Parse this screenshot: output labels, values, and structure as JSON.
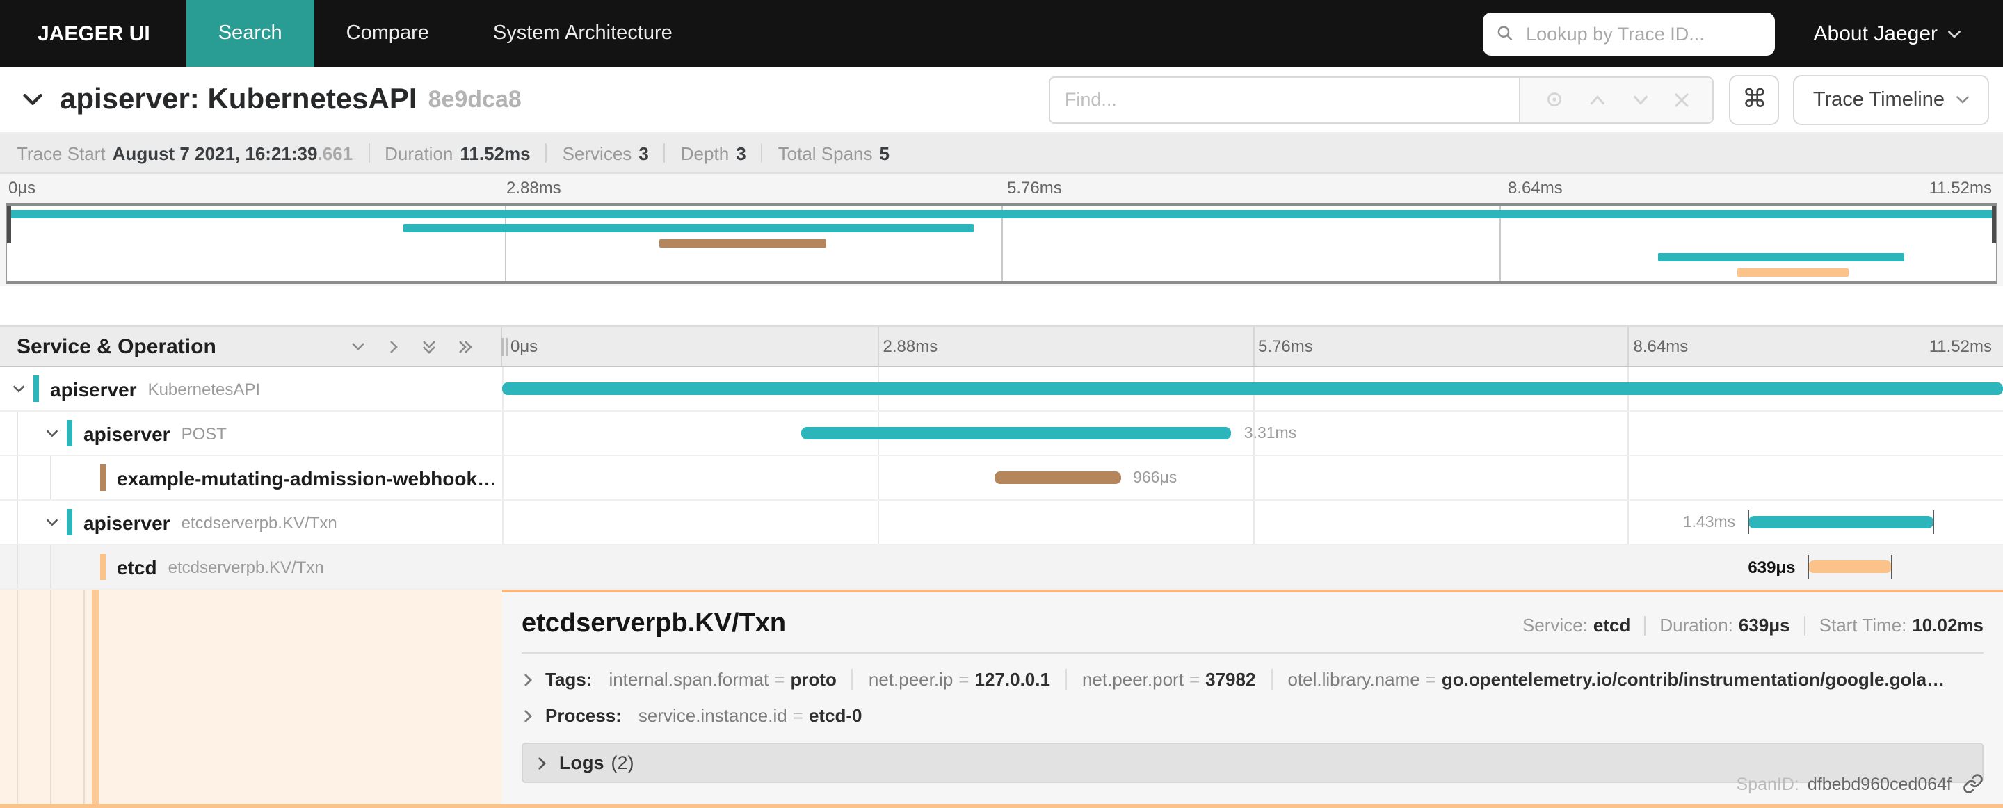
{
  "nav": {
    "brand": "JAEGER UI",
    "items": [
      {
        "label": "Search",
        "active": true
      },
      {
        "label": "Compare",
        "active": false
      },
      {
        "label": "System Architecture",
        "active": false
      }
    ],
    "lookup_placeholder": "Lookup by Trace ID...",
    "about_label": "About Jaeger"
  },
  "trace_bar": {
    "title": "apiserver: KubernetesAPI",
    "trace_id": "8e9dca8",
    "find_placeholder": "Find...",
    "keyboard_shortcut": "⌘",
    "view_selector_label": "Trace Timeline"
  },
  "summary": [
    {
      "label": "Trace Start",
      "value": "August 7 2021, 16:21:39",
      "suffix": ".661"
    },
    {
      "label": "Duration",
      "value": "11.52ms"
    },
    {
      "label": "Services",
      "value": "3"
    },
    {
      "label": "Depth",
      "value": "3"
    },
    {
      "label": "Total Spans",
      "value": "5"
    }
  ],
  "timeline": {
    "header_label": "Service & Operation",
    "ticks": [
      "0μs",
      "2.88ms",
      "5.76ms",
      "8.64ms",
      "11.52ms"
    ]
  },
  "spans": [
    {
      "service": "apiserver",
      "operation": "KubernetesAPI",
      "depth": 0,
      "color": "#2cb5ba",
      "start_pct": 0,
      "width_pct": 100,
      "duration_label": "",
      "label_side": "none",
      "expandable": true,
      "selected": false,
      "end_ticks": false
    },
    {
      "service": "apiserver",
      "operation": "POST",
      "depth": 1,
      "color": "#2cb5ba",
      "start_pct": 19.9,
      "width_pct": 28.7,
      "duration_label": "3.31ms",
      "label_side": "right",
      "expandable": true,
      "selected": false,
      "end_ticks": false
    },
    {
      "service": "example-mutating-admission-webhook…",
      "operation": "",
      "depth": 2,
      "color": "#b5855c",
      "start_pct": 32.8,
      "width_pct": 8.4,
      "duration_label": "966μs",
      "label_side": "right",
      "expandable": false,
      "selected": false,
      "end_ticks": false
    },
    {
      "service": "apiserver",
      "operation": "etcdserverpb.KV/Txn",
      "depth": 1,
      "color": "#2cb5ba",
      "start_pct": 83.0,
      "width_pct": 12.4,
      "duration_label": "1.43ms",
      "label_side": "left",
      "expandable": true,
      "selected": false,
      "end_ticks": true
    },
    {
      "service": "etcd",
      "operation": "etcdserverpb.KV/Txn",
      "depth": 2,
      "color": "#fbc28a",
      "start_pct": 87.0,
      "width_pct": 5.6,
      "duration_label": "639μs",
      "label_side": "left",
      "expandable": false,
      "selected": true,
      "end_ticks": true
    }
  ],
  "detail": {
    "operation": "etcdserverpb.KV/Txn",
    "overview": [
      {
        "label": "Service:",
        "value": "etcd"
      },
      {
        "label": "Duration:",
        "value": "639μs"
      },
      {
        "label": "Start Time:",
        "value": "10.02ms"
      }
    ],
    "tags_label": "Tags:",
    "tags": [
      {
        "key": "internal.span.format",
        "value": "proto"
      },
      {
        "key": "net.peer.ip",
        "value": "127.0.0.1"
      },
      {
        "key": "net.peer.port",
        "value": "37982"
      },
      {
        "key": "otel.library.name",
        "value": "go.opentelemetry.io/contrib/instrumentation/google.gola…"
      }
    ],
    "process_label": "Process:",
    "process_tags": [
      {
        "key": "service.instance.id",
        "value": "etcd-0"
      }
    ],
    "logs_label": "Logs",
    "logs_count": "(2)",
    "span_id_label": "SpanID:",
    "span_id": "dfbebd960ced064f"
  },
  "colors": {
    "nav_active": "#299d94",
    "span_teal": "#2cb5ba",
    "span_brown": "#b5855c",
    "span_orange": "#fbc28a",
    "selected_border": "#f7b77f"
  }
}
